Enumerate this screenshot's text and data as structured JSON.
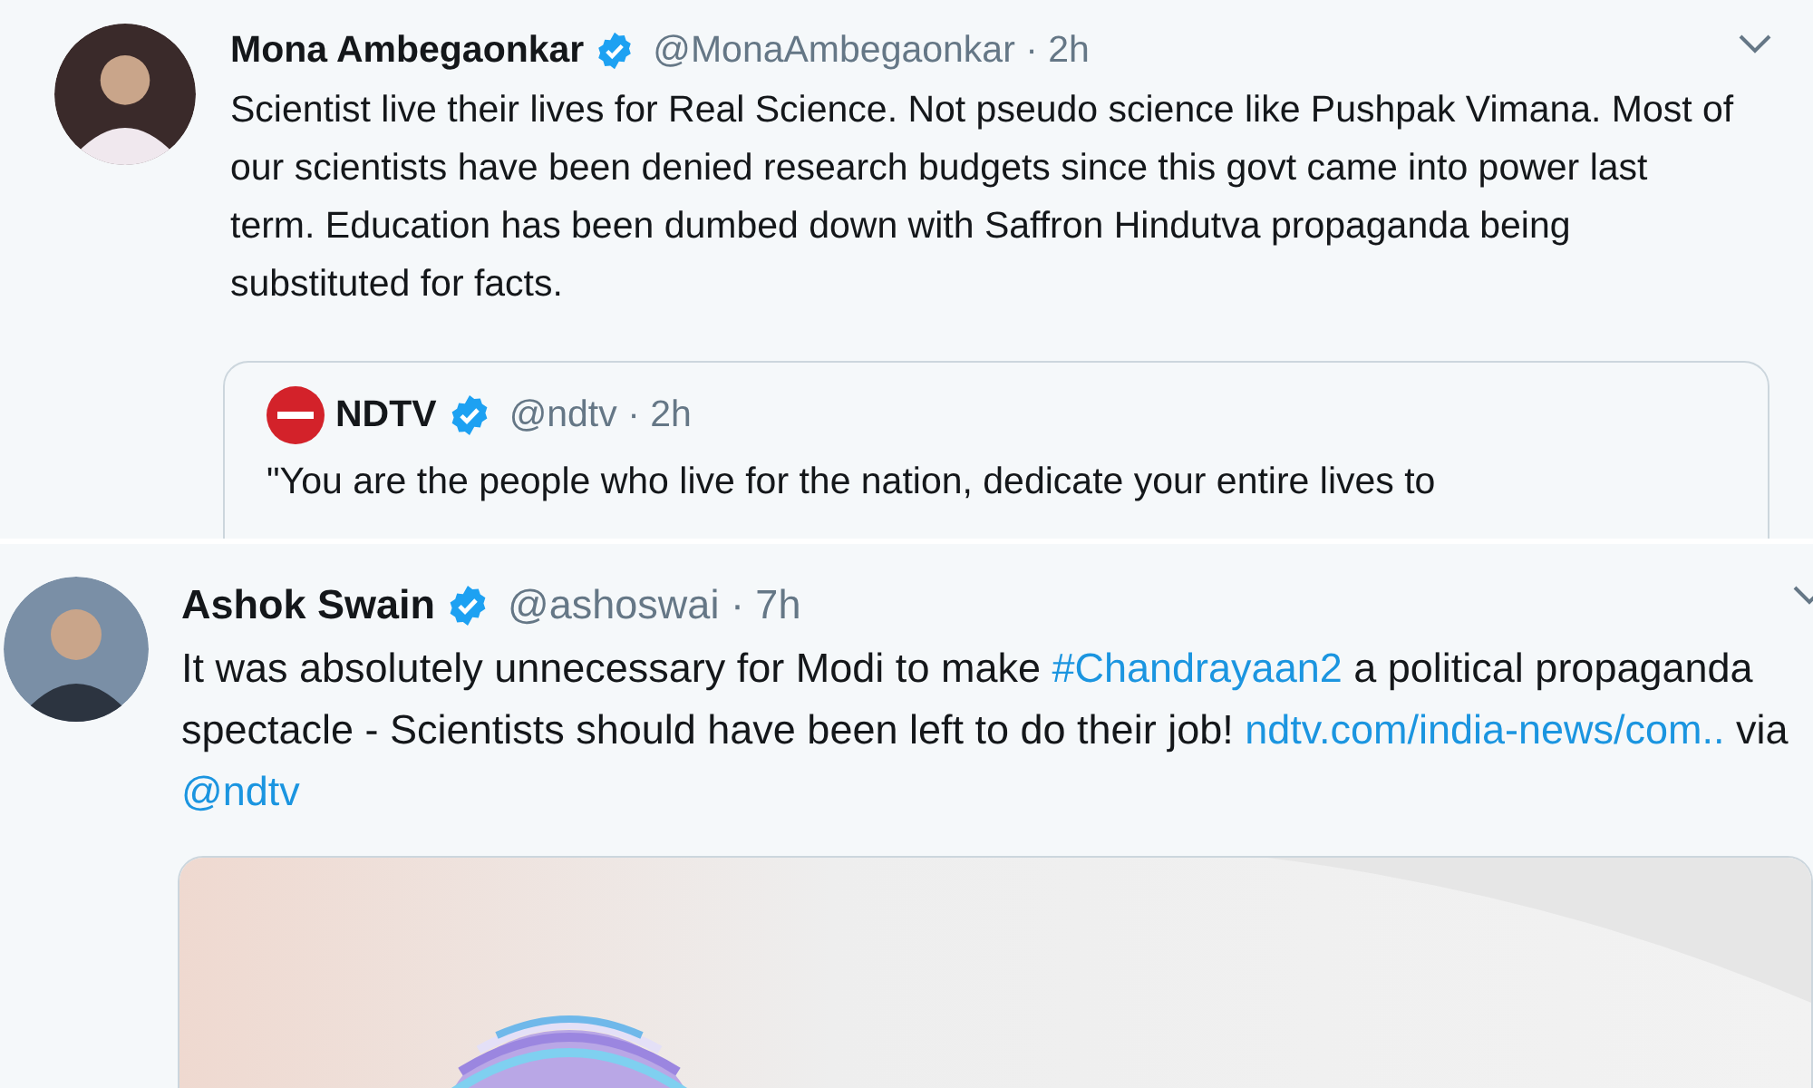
{
  "tweets": [
    {
      "name": "Mona Ambegaonkar",
      "verified": true,
      "meta": "@MonaAmbegaonkar · 2h",
      "body": [
        {
          "kind": "text",
          "text": "Scientist live their lives for Real Science. Not pseudo science like Pushpak Vimana. Most of our scientists have been denied research budgets since this govt came into power last term. Education has been dumbed down with Saffron Hindutva propaganda being substituted for facts."
        }
      ],
      "quote": {
        "name": "NDTV",
        "verified": true,
        "meta": "@ndtv · 2h",
        "text": "\"You are the people who live for the nation, dedicate your entire lives to"
      }
    },
    {
      "name": "Ashok Swain",
      "verified": true,
      "meta": "@ashoswai · 7h",
      "body": [
        {
          "kind": "text",
          "text": "It was absolutely unnecessary for Modi to make "
        },
        {
          "kind": "link",
          "text": "#Chandrayaan2"
        },
        {
          "kind": "text",
          "text": " a political propaganda spectacle - Scientists should have been left to do their job! "
        },
        {
          "kind": "link",
          "text": "ndtv.com/india-news/com.."
        },
        {
          "kind": "text",
          "text": " via "
        },
        {
          "kind": "link",
          "text": "@ndtv"
        }
      ]
    }
  ]
}
